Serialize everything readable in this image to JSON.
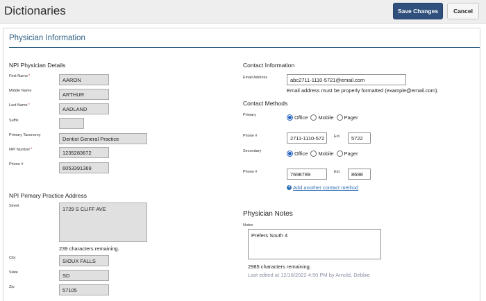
{
  "app": {
    "title": "Dictionaries"
  },
  "toolbar": {
    "save_label": "Save Changes",
    "cancel_label": "Cancel"
  },
  "card": {
    "title": "Physician Information"
  },
  "npi_details": {
    "heading": "NPI Physician Details",
    "first_name": {
      "label": "First Name",
      "required": "*",
      "value": "AARON"
    },
    "middle_name": {
      "label": "Middle Name",
      "value": "ARTHUR"
    },
    "last_name": {
      "label": "Last Name",
      "required": "*",
      "value": "AADLAND"
    },
    "suffix": {
      "label": "Suffix",
      "value": ""
    },
    "taxonomy": {
      "label": "Primary Taxonomy",
      "value": "Dentist General Practice"
    },
    "npi_number": {
      "label": "NPI Number",
      "required": "*",
      "value": "1235283672"
    },
    "phone": {
      "label": "Phone #",
      "value": "6053391369"
    }
  },
  "address": {
    "heading": "NPI Primary Practice Address",
    "street": {
      "label": "Street",
      "value": "1729 S CLIFF AVE"
    },
    "remaining": "239 characters remaining.",
    "city": {
      "label": "City",
      "value": "SIOUX FALLS"
    },
    "state": {
      "label": "State",
      "value": "SD"
    },
    "zip": {
      "label": "Zip",
      "value": "57105"
    }
  },
  "contact": {
    "heading": "Contact Information",
    "email": {
      "label": "Email Address",
      "value": "abc2711-1110-5721@email.com",
      "hint": "Email address must be properly formatted (example@email.com)."
    }
  },
  "methods": {
    "heading": "Contact Methods",
    "primary": {
      "label": "Primary",
      "options": [
        "Office",
        "Mobile",
        "Pager"
      ],
      "selected": "Office"
    },
    "primary_phone": {
      "label": "Phone #",
      "value": "2711-1110-572",
      "ext_label": "Ext.",
      "ext_value": "5722"
    },
    "secondary": {
      "label": "Secondary",
      "options": [
        "Office",
        "Mobile",
        "Pager"
      ],
      "selected": "Office"
    },
    "secondary_phone": {
      "label": "Phone #",
      "value": "7698789",
      "ext_label": "Ext.",
      "ext_value": "8698"
    },
    "add_link": "Add another contact method"
  },
  "notes": {
    "heading": "Physician Notes",
    "label": "Notes",
    "value": "Prefers South 4",
    "remaining": "2985 characters remaining.",
    "last_edited": "Last edited at 12/16/2022 4:50 PM by",
    "editor": "Arnold,  Debbie"
  },
  "colors": {
    "accent": "#2f5f82",
    "save_button": "#2f4f7c",
    "link": "#2f6fb5"
  }
}
